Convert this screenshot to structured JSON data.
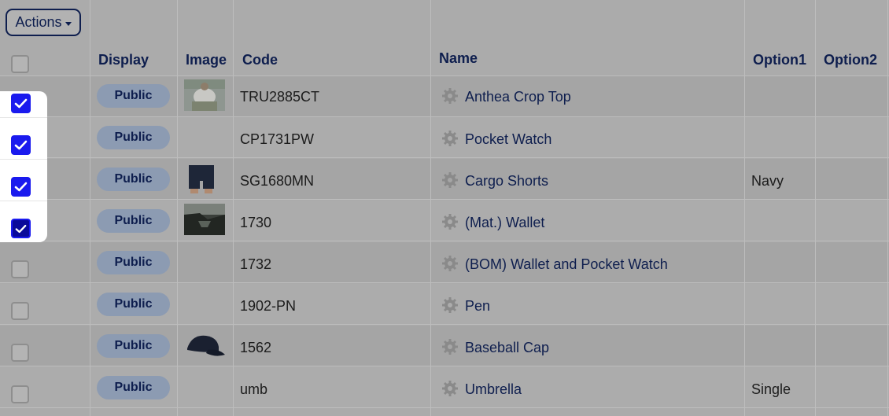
{
  "toolbar": {
    "actions_label": "Actions"
  },
  "columns": [
    "Display",
    "Image",
    "Code",
    "Name",
    "Option1",
    "Option2"
  ],
  "rows": [
    {
      "display": "Public",
      "code": "TRU2885CT",
      "name": "Anthea Crop Top",
      "option1": "",
      "image": "crop-top-photo",
      "checked": true
    },
    {
      "display": "Public",
      "code": "CP1731PW",
      "name": "Pocket Watch",
      "option1": "",
      "image": "",
      "checked": true
    },
    {
      "display": "Public",
      "code": "SG1680MN",
      "name": "Cargo Shorts",
      "option1": "Navy",
      "image": "cargo-shorts-photo",
      "checked": true
    },
    {
      "display": "Public",
      "code": "1730",
      "name": "(Mat.) Wallet",
      "option1": "",
      "image": "wallet-photo",
      "checked": true
    },
    {
      "display": "Public",
      "code": "1732",
      "name": "(BOM) Wallet and Pocket Watch",
      "option1": "",
      "image": "",
      "checked": false
    },
    {
      "display": "Public",
      "code": "1902-PN",
      "name": "Pen",
      "option1": "",
      "image": "",
      "checked": false
    },
    {
      "display": "Public",
      "code": "1562",
      "name": "Baseball Cap",
      "option1": "",
      "image": "baseball-cap-photo",
      "checked": false
    },
    {
      "display": "Public",
      "code": "umb",
      "name": "Umbrella",
      "option1": "Single",
      "image": "",
      "checked": false
    }
  ],
  "colors": {
    "navy": "#0e1e4e",
    "check_blue": "#1a1aee",
    "overlay_gray": "#ababab"
  }
}
